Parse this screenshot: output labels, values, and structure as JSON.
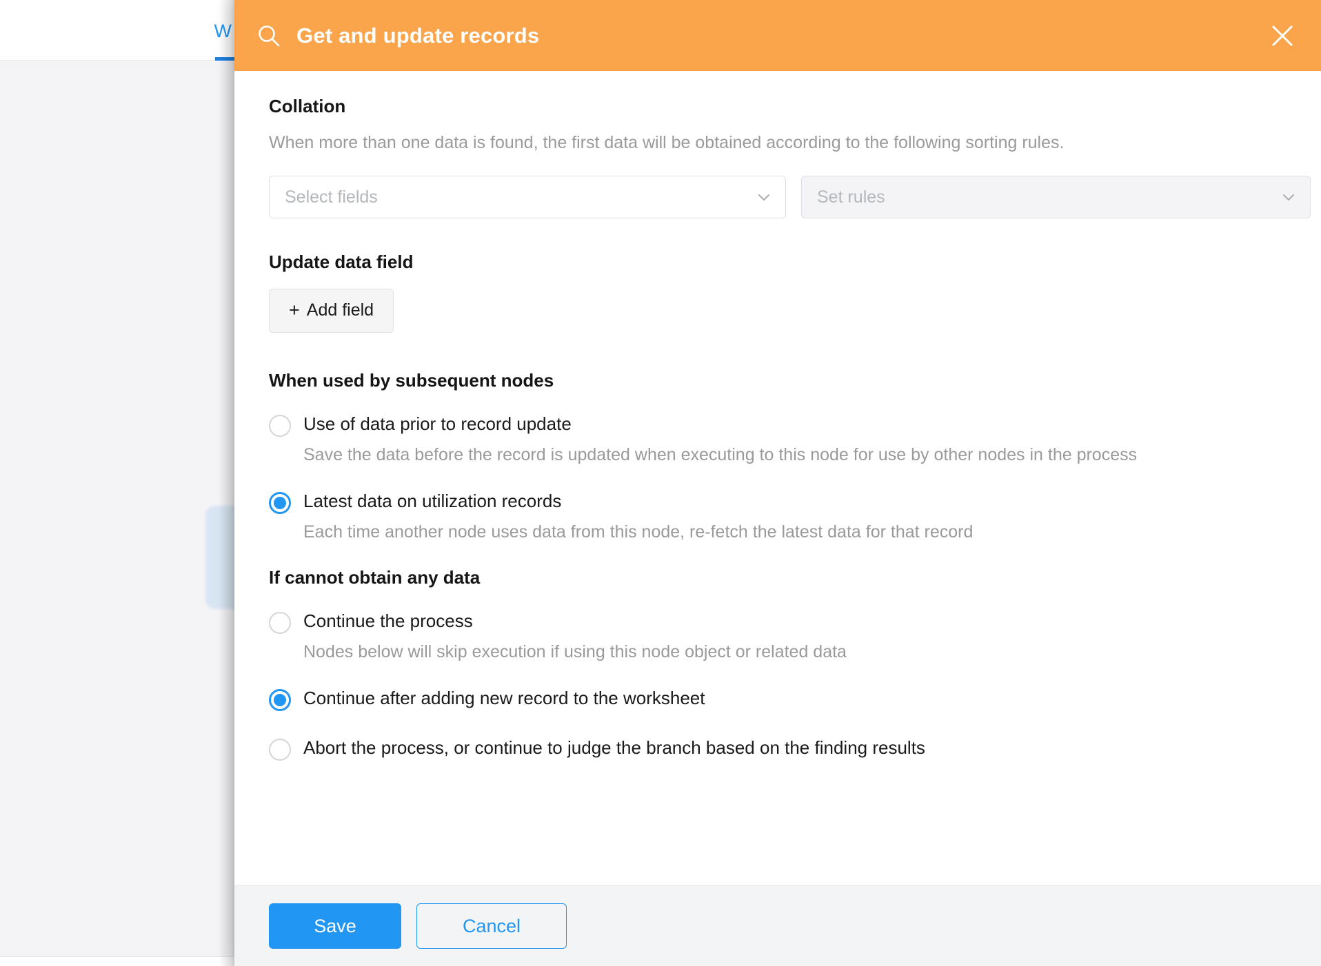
{
  "background": {
    "tab_label": "W",
    "icons": {
      "tab_indicator": "active-tab-underline"
    }
  },
  "modal": {
    "title": "Get and update records",
    "icons": {
      "header": "search-icon",
      "close": "close-icon",
      "select_chevron": "chevron-down-icon",
      "add": "plus-icon"
    },
    "collation": {
      "title": "Collation",
      "description": "When more than one data is found, the first data will be obtained according to the following sorting rules.",
      "fields_placeholder": "Select fields",
      "rules_placeholder": "Set rules"
    },
    "update_data_field": {
      "title": "Update data field",
      "add_field_label": "Add field",
      "add_field_plus": "+"
    },
    "subsequent_nodes": {
      "title": "When used by subsequent nodes",
      "options": [
        {
          "label": "Use of data prior to record update",
          "description": "Save the data before the record is updated when executing to this node for use by other nodes in the process",
          "selected": false
        },
        {
          "label": "Latest data on utilization records",
          "description": "Each time another node uses data from this node, re-fetch the latest data for that record",
          "selected": true
        }
      ]
    },
    "no_data": {
      "title": "If cannot obtain any data",
      "options": [
        {
          "label": "Continue the process",
          "description": "Nodes below will skip execution if using this node object or related data",
          "selected": false
        },
        {
          "label": "Continue after adding new record to the worksheet",
          "description": "",
          "selected": true
        },
        {
          "label": "Abort the process, or continue to judge the branch based on the finding results",
          "description": "",
          "selected": false
        }
      ]
    },
    "footer": {
      "save_label": "Save",
      "cancel_label": "Cancel"
    },
    "colors": {
      "header_bg": "#faa44b",
      "primary": "#2196f3",
      "footer_bg": "#f3f4f5",
      "muted_text": "#9a9a9a"
    }
  }
}
